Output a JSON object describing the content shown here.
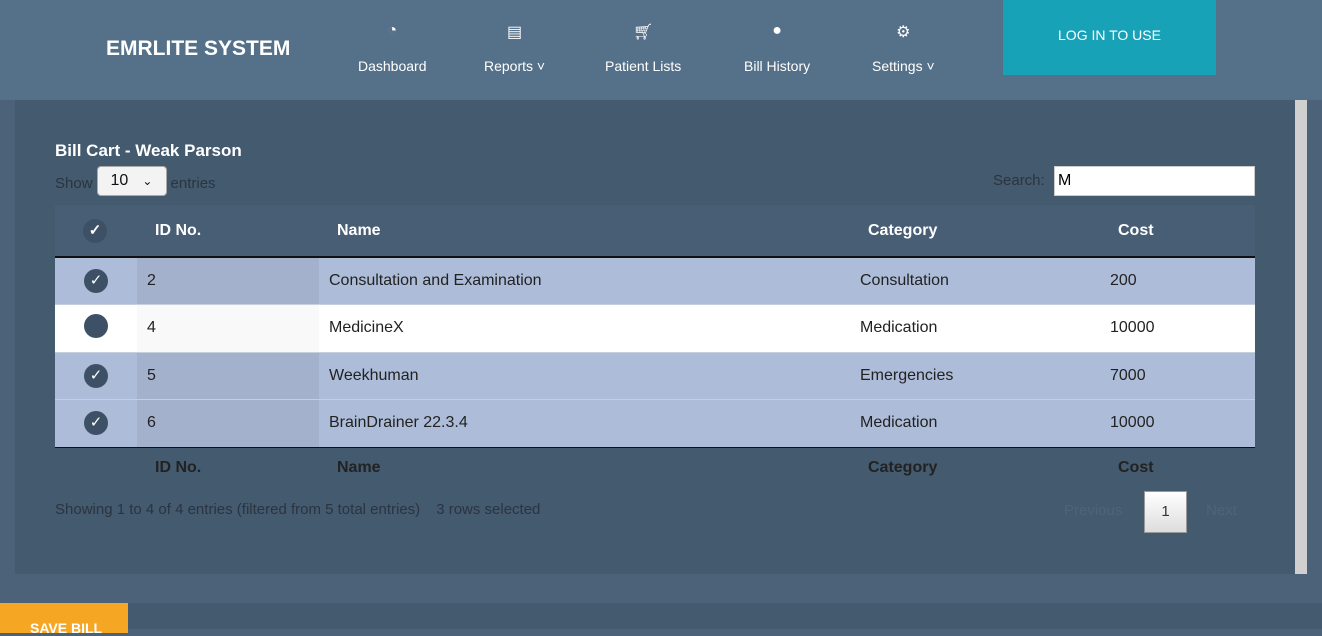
{
  "header": {
    "brand": "EMRLITE SYSTEM",
    "nav": [
      {
        "label": "Dashboard",
        "icon": "tachometer-icon"
      },
      {
        "label": "Reports ˅",
        "icon": "file-icon"
      },
      {
        "label": "Patient Lists",
        "icon": "cart-icon"
      },
      {
        "label": "Bill History",
        "icon": "user-icon"
      },
      {
        "label": "Settings ˅",
        "icon": "gear-icon"
      }
    ],
    "login": "LOG IN TO USE"
  },
  "main": {
    "title": "Bill Cart - Weak Parson",
    "show": "Show",
    "entries_value": "10",
    "entries": "entries",
    "search_label": "Search:",
    "search_value": "M",
    "columns": [
      "ID No.",
      "Name",
      "Category",
      "Cost"
    ],
    "rows": [
      {
        "selected": true,
        "cells": [
          "2",
          "Consultation and Examination",
          "Consultation",
          "200"
        ]
      },
      {
        "selected": false,
        "cells": [
          "4",
          "MedicineX",
          "Medication",
          "10000"
        ]
      },
      {
        "selected": true,
        "cells": [
          "5",
          "Weekhuman",
          "Emergencies",
          "7000"
        ]
      },
      {
        "selected": true,
        "cells": [
          "6",
          "BrainDrainer 22.3.4",
          "Medication",
          "10000"
        ]
      }
    ],
    "info": "Showing 1 to 4 of 4 entries (filtered from 5 total entries)",
    "selected_info": "3 rows selected",
    "pagination": {
      "previous": "Previous",
      "page": "1",
      "next": "Next"
    }
  },
  "save_button": "SAVE BILL",
  "colors": {
    "header": "#557189",
    "accent": "#17a2b8",
    "save": "#f5a623",
    "selected_row": "#adbcd8"
  }
}
